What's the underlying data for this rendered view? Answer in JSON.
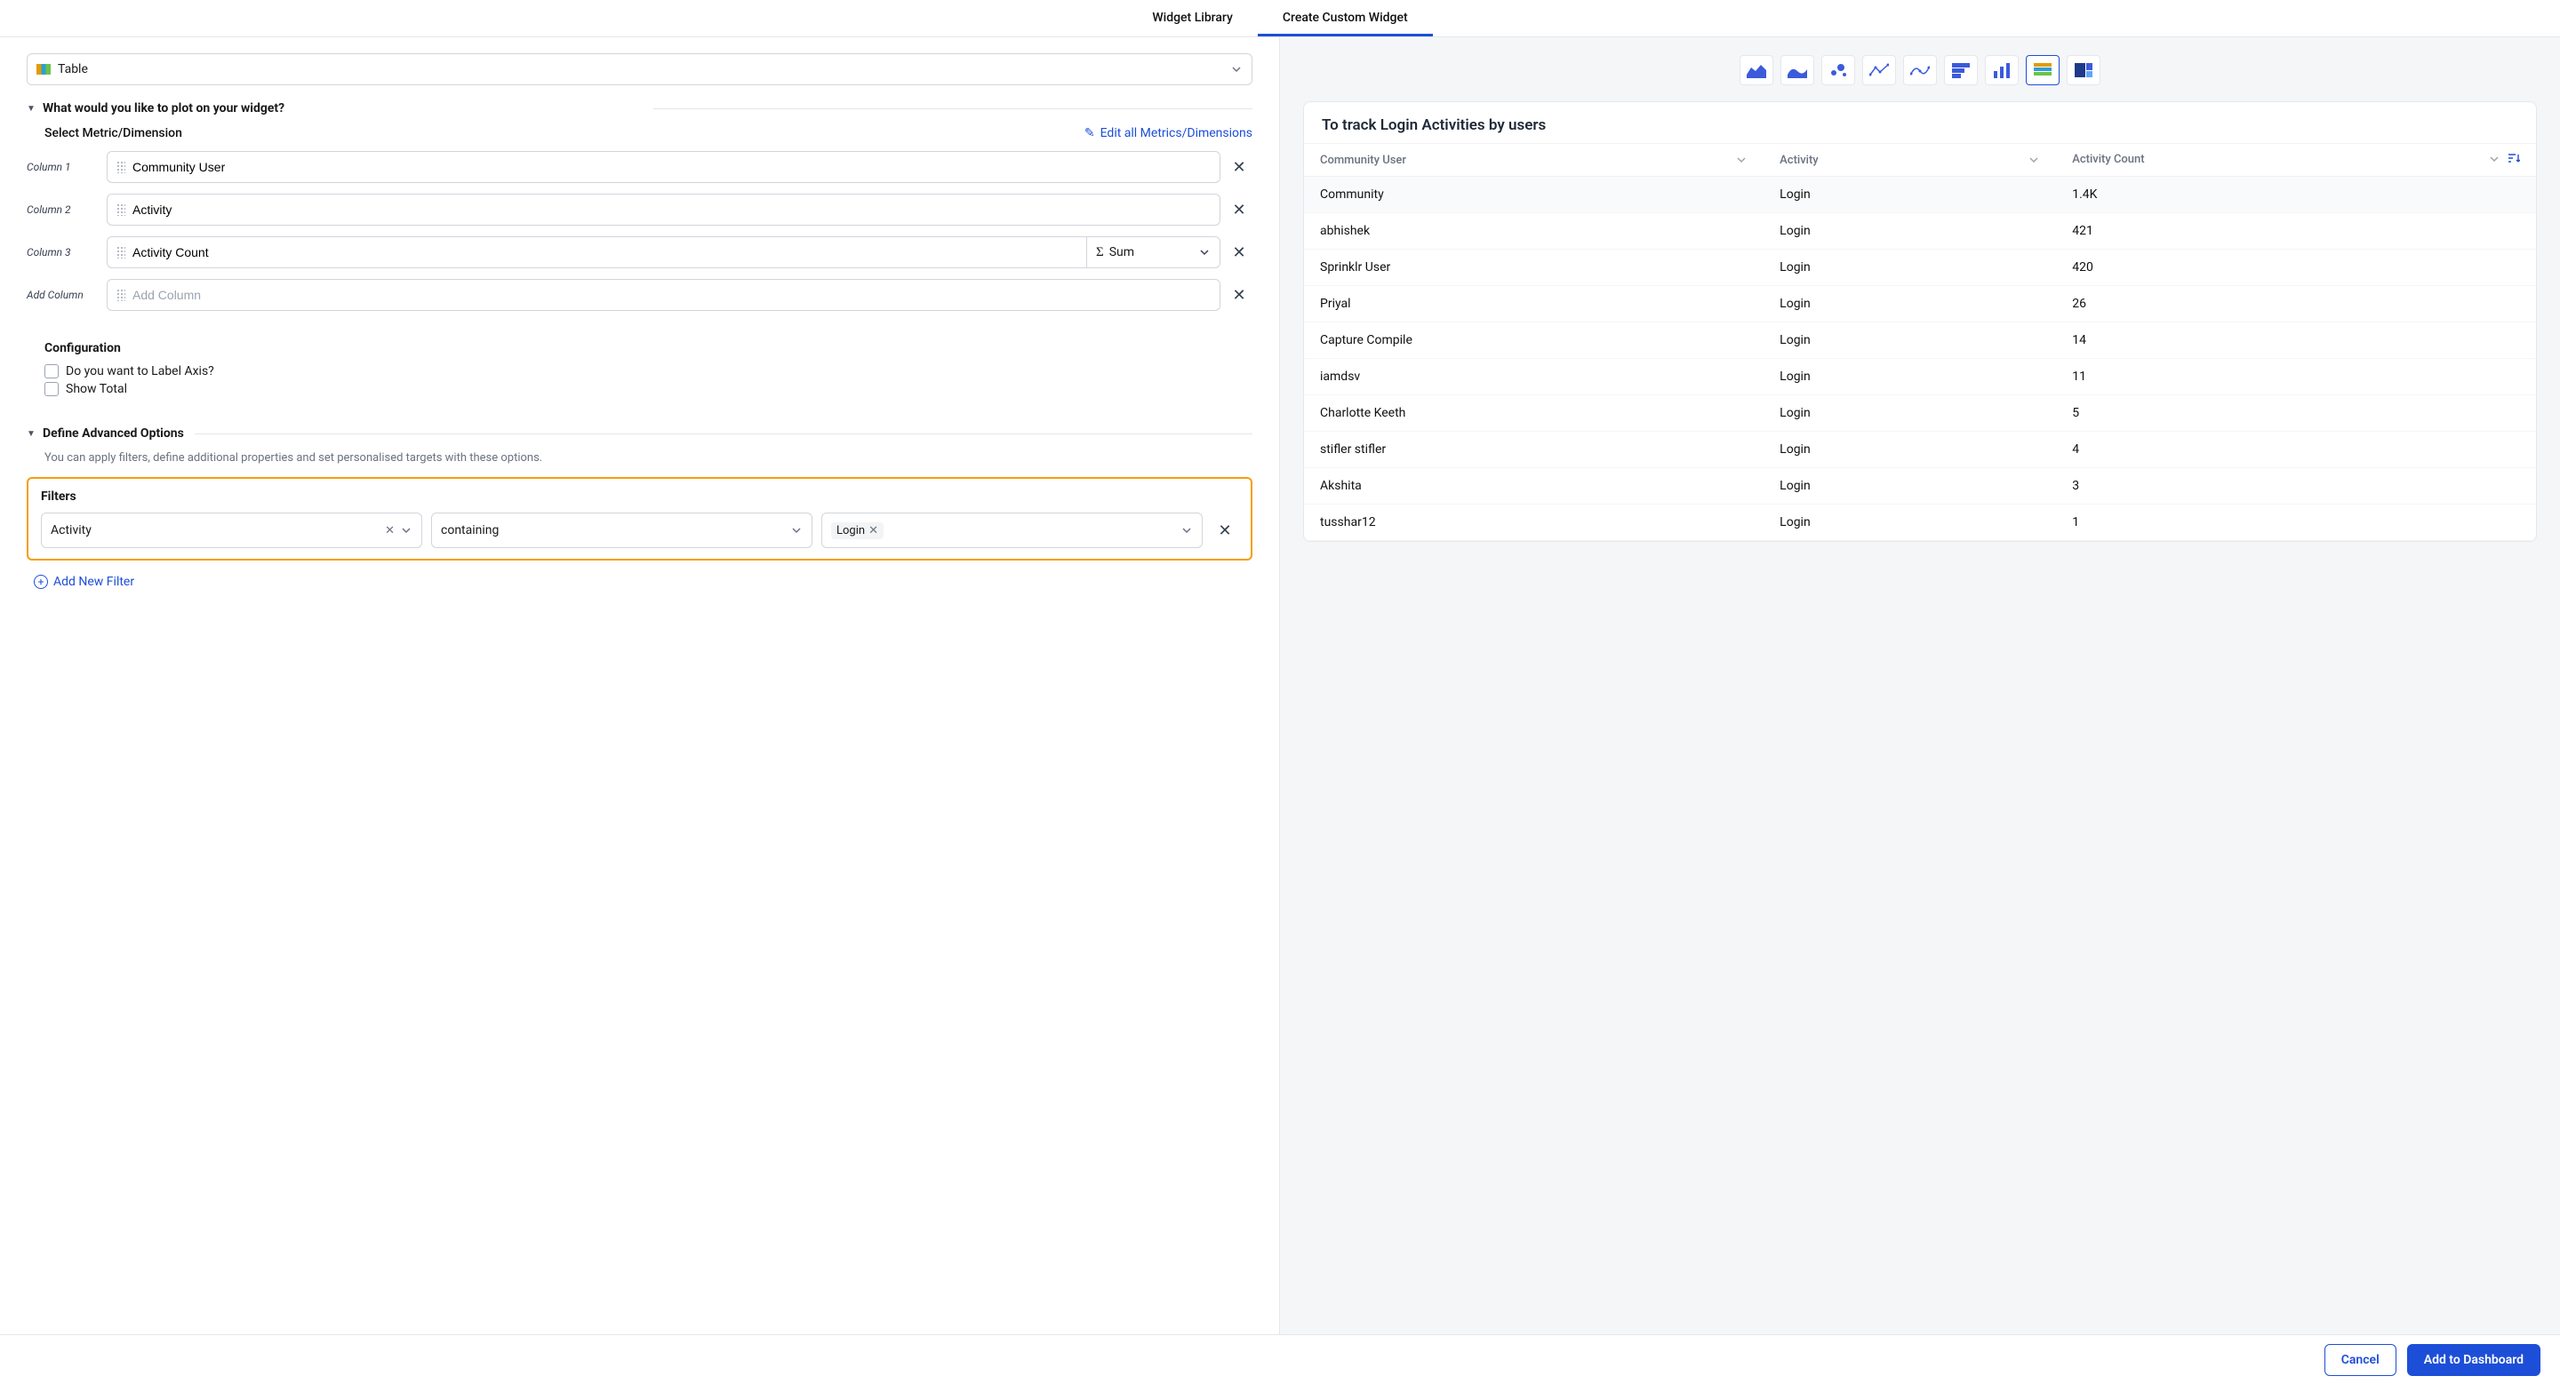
{
  "tabs": {
    "library": "Widget Library",
    "custom": "Create Custom Widget"
  },
  "widget_type_select": {
    "label": "Table"
  },
  "plot_section": {
    "title": "What would you like to plot on your widget?",
    "select_label": "Select Metric/Dimension",
    "edit_all_link": "Edit all Metrics/Dimensions"
  },
  "columns": [
    {
      "label": "Column 1",
      "value": "Community User",
      "has_agg": false
    },
    {
      "label": "Column 2",
      "value": "Activity",
      "has_agg": false
    },
    {
      "label": "Column 3",
      "value": "Activity Count",
      "has_agg": true,
      "agg": "Sum"
    }
  ],
  "add_column": {
    "label": "Add Column",
    "placeholder": "Add Column"
  },
  "configuration": {
    "title": "Configuration",
    "label_axis": "Do you want to Label Axis?",
    "show_total": "Show Total"
  },
  "advanced": {
    "title": "Define Advanced Options",
    "subtitle": "You can apply filters, define additional properties and set personalised targets with these options."
  },
  "filters": {
    "title": "Filters",
    "field": "Activity",
    "operator": "containing",
    "value_chip": "Login",
    "add_new": "Add New Filter"
  },
  "preview": {
    "title": "To track Login Activities by users",
    "headers": {
      "user": "Community User",
      "activity": "Activity",
      "count": "Activity Count"
    },
    "rows": [
      {
        "user": "Community",
        "activity": "Login",
        "count": "1.4K"
      },
      {
        "user": "abhishek",
        "activity": "Login",
        "count": "421"
      },
      {
        "user": "Sprinklr User",
        "activity": "Login",
        "count": "420"
      },
      {
        "user": "Priyal",
        "activity": "Login",
        "count": "26"
      },
      {
        "user": "Capture Compile",
        "activity": "Login",
        "count": "14"
      },
      {
        "user": "iamdsv",
        "activity": "Login",
        "count": "11"
      },
      {
        "user": "Charlotte Keeth",
        "activity": "Login",
        "count": "5"
      },
      {
        "user": "stifler stifler",
        "activity": "Login",
        "count": "4"
      },
      {
        "user": "Akshita",
        "activity": "Login",
        "count": "3"
      },
      {
        "user": "tusshar12",
        "activity": "Login",
        "count": "1"
      }
    ]
  },
  "buttons": {
    "cancel": "Cancel",
    "add": "Add to Dashboard"
  },
  "chart_type_icons": [
    "area-chart-icon",
    "spline-area-icon",
    "bubble-chart-icon",
    "line-chart-icon",
    "line-chart-smooth-icon",
    "stacked-bar-icon",
    "bar-chart-icon",
    "table-icon",
    "treemap-icon"
  ],
  "chart_data": {
    "type": "table",
    "title": "To track Login Activities by users",
    "columns": [
      "Community User",
      "Activity",
      "Activity Count"
    ],
    "rows": [
      [
        "Community",
        "Login",
        "1.4K"
      ],
      [
        "abhishek",
        "Login",
        421
      ],
      [
        "Sprinklr User",
        "Login",
        420
      ],
      [
        "Priyal",
        "Login",
        26
      ],
      [
        "Capture Compile",
        "Login",
        14
      ],
      [
        "iamdsv",
        "Login",
        11
      ],
      [
        "Charlotte Keeth",
        "Login",
        5
      ],
      [
        "stifler stifler",
        "Login",
        4
      ],
      [
        "Akshita",
        "Login",
        3
      ],
      [
        "tusshar12",
        "Login",
        1
      ]
    ]
  }
}
